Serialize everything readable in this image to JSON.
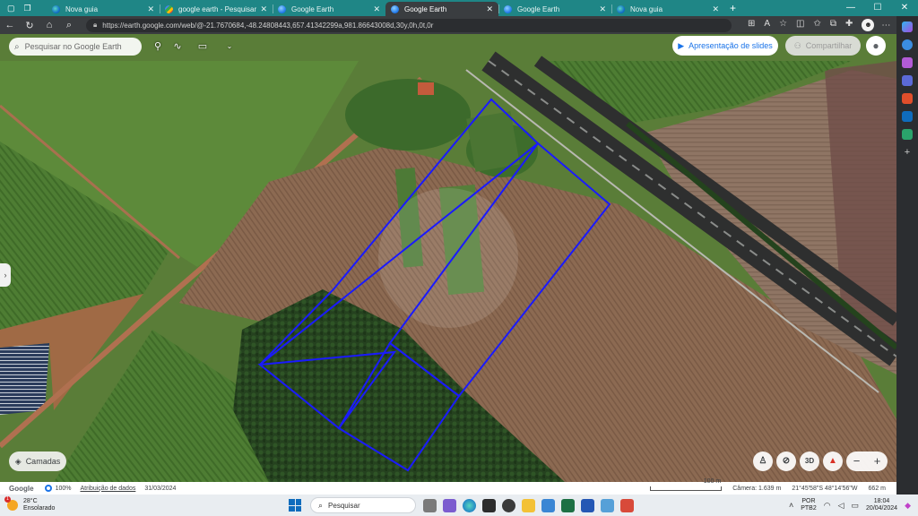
{
  "tabs": [
    {
      "label": "Nova guia",
      "icon": "edge-icon",
      "active": false
    },
    {
      "label": "google earth - Pesquisar",
      "icon": "google-icon",
      "active": false
    },
    {
      "label": "Google Earth",
      "icon": "earth-icon",
      "active": false
    },
    {
      "label": "Google Earth",
      "icon": "earth-icon",
      "active": true
    },
    {
      "label": "Google Earth",
      "icon": "earth-icon",
      "active": false
    },
    {
      "label": "Nova guia",
      "icon": "edge-icon",
      "active": false
    }
  ],
  "address": {
    "url": "https://earth.google.com/web/@-21.7670684,-48.24808443,657.41342299a,981.86643008d,30y,0h,0t,0r"
  },
  "earth": {
    "search_placeholder": "Pesquisar no Google Earth",
    "slides_label": "Apresentação de slides",
    "share_label": "Compartilhar",
    "layers_label": "Camadas",
    "view_3d_label": "3D"
  },
  "statusbar": {
    "google_label": "Google",
    "zoom_percent": "100%",
    "attribution_label": "Atribuição de dados",
    "imagery_date": "31/03/2024",
    "scale_label": "100 m",
    "camera_label": "Câmera: 1.639 m",
    "coordinates": "21°45'58\"S 48°14'56\"W",
    "elevation": "662 m"
  },
  "taskbar": {
    "weather_temp": "28°C",
    "weather_desc": "Ensolarado",
    "search_placeholder": "Pesquisar",
    "lang_line1": "POR",
    "lang_line2": "PTB2",
    "time": "18:04",
    "date": "20/04/2024"
  },
  "colors": {
    "tabstrip": "#1f8686",
    "polygon_stroke": "#1a1aff",
    "accent": "#1a73e8"
  }
}
